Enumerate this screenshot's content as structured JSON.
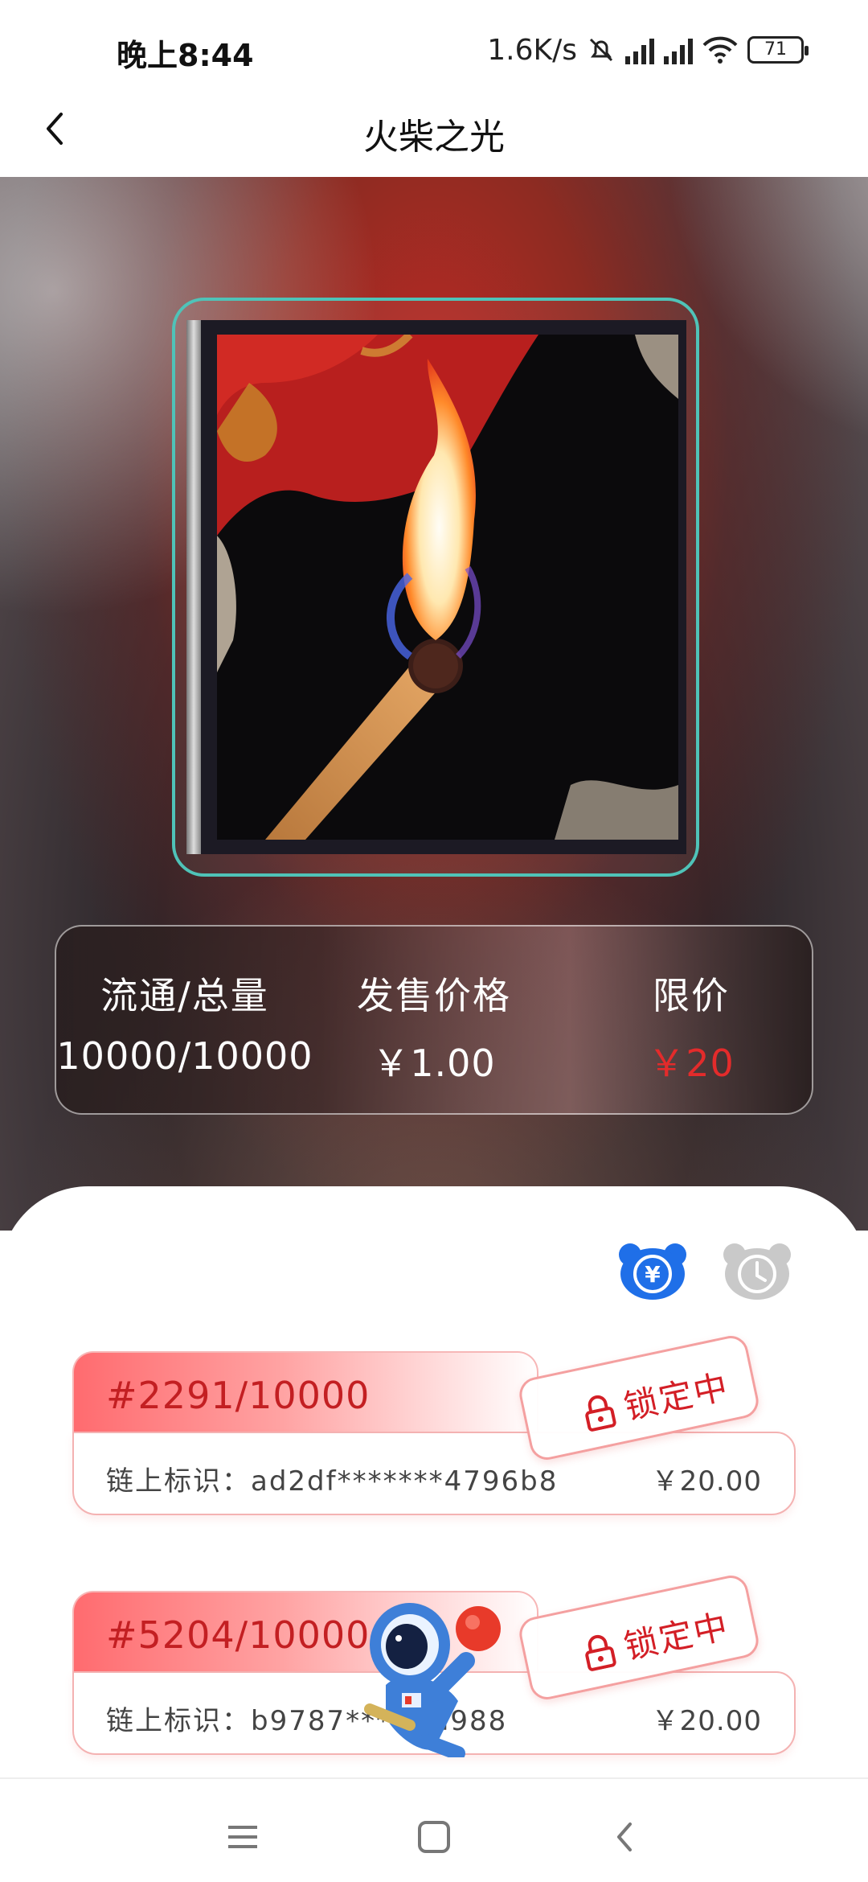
{
  "status_bar": {
    "time": "晚上8:44",
    "speed": "1.6K/s",
    "battery": "71"
  },
  "header": {
    "title": "火柴之光"
  },
  "stats": {
    "circulation_label": "流通/总量",
    "circulation_value": "10000/10000",
    "price_label": "发售价格",
    "price_value": "￥1.00",
    "limit_label": "限价",
    "limit_value": "￥20"
  },
  "toolbar": {
    "icons": [
      "yen-bear-icon",
      "clock-icon"
    ]
  },
  "items": [
    {
      "serial": "#2291/10000",
      "chain": "链上标识：ad2df*******4796b8",
      "price": "￥20.00",
      "status": "锁定中"
    },
    {
      "serial": "#5204/10000",
      "chain": "链上标识：b9787***      efd988",
      "price": "￥20.00",
      "status": "锁定中"
    }
  ],
  "colors": {
    "accent_teal": "#4fc3b8",
    "price_red": "#e32b2b",
    "lock_red": "#d31f26",
    "toolbar_blue": "#1f6fe8"
  }
}
